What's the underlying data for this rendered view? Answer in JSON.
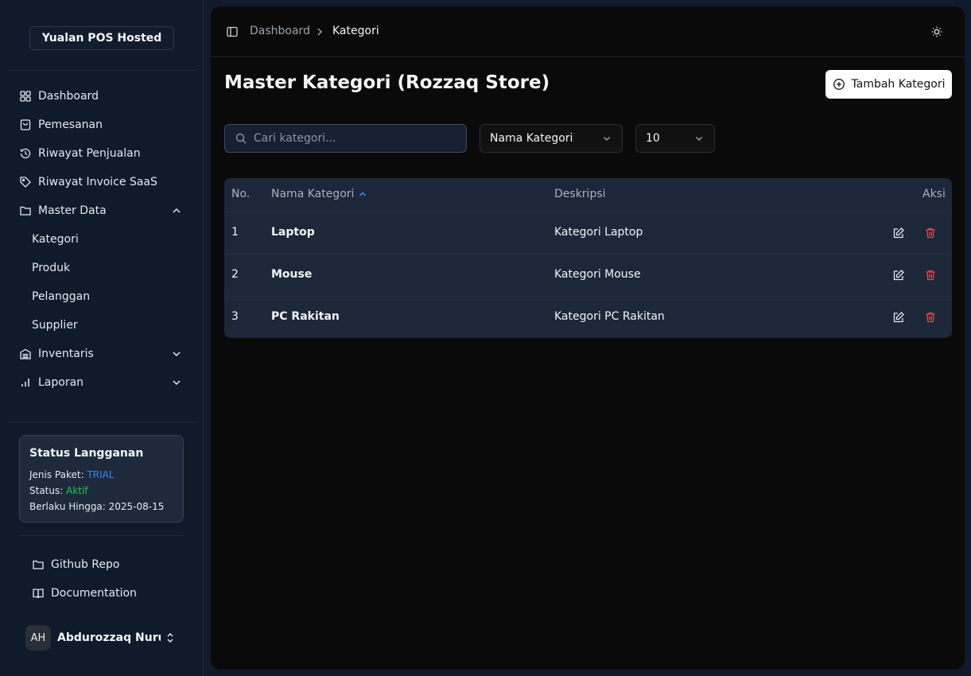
{
  "sidebar": {
    "brand": "Yualan POS Hosted",
    "nav": [
      {
        "label": "Dashboard",
        "icon": "grid-icon"
      },
      {
        "label": "Pemesanan",
        "icon": "shopping-bag-icon"
      },
      {
        "label": "Riwayat Penjualan",
        "icon": "history-icon"
      },
      {
        "label": "Riwayat Invoice SaaS",
        "icon": "tag-icon"
      },
      {
        "label": "Master Data",
        "icon": "folder-icon",
        "expanded": true
      }
    ],
    "sub_items": [
      "Kategori",
      "Produk",
      "Pelanggan",
      "Supplier"
    ],
    "nav_bottom": [
      {
        "label": "Inventaris",
        "icon": "warehouse-icon"
      },
      {
        "label": "Laporan",
        "icon": "bar-chart-icon"
      }
    ],
    "status": {
      "title": "Status Langganan",
      "paket_label": "Jenis Paket: ",
      "paket_value": "TRIAL",
      "status_label": "Status: ",
      "status_value": "Aktif",
      "berlaku_label": "Berlaku Hingga: ",
      "berlaku_value": "2025-08-15"
    },
    "footer_links": [
      {
        "label": "Github Repo",
        "icon": "folder-icon"
      },
      {
        "label": "Documentation",
        "icon": "book-open-icon"
      }
    ],
    "user": {
      "initials": "AH",
      "name": "Abdurozzaq Nuru..."
    }
  },
  "topbar": {
    "breadcrumb": [
      "Dashboard",
      "Kategori"
    ]
  },
  "main": {
    "title": "Master Kategori (Rozzaq Store)",
    "add_button": "Tambah Kategori",
    "search_placeholder": "Cari kategori...",
    "sort_select": "Nama Kategori",
    "page_size": "10",
    "table": {
      "headers": [
        "No.",
        "Nama Kategori",
        "Deskripsi",
        "Aksi"
      ],
      "rows": [
        {
          "no": "1",
          "name": "Laptop",
          "desc": "Kategori Laptop"
        },
        {
          "no": "2",
          "name": "Mouse",
          "desc": "Kategori Mouse"
        },
        {
          "no": "3",
          "name": "PC Rakitan",
          "desc": "Kategori PC Rakitan"
        }
      ]
    }
  },
  "colors": {
    "accent_blue": "#3b82f6",
    "status_green": "#22c55e",
    "delete_red": "#ef4444"
  }
}
